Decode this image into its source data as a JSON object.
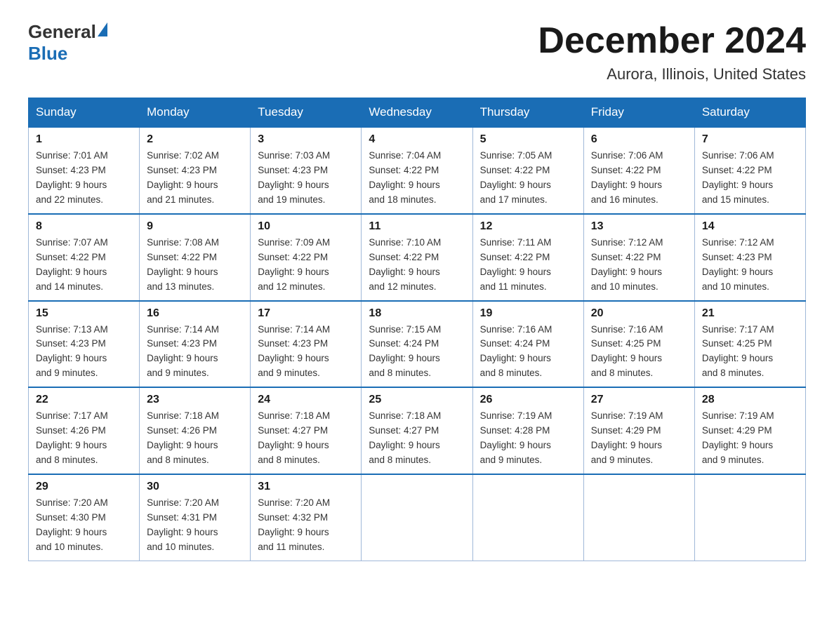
{
  "header": {
    "logo_general": "General",
    "logo_blue": "Blue",
    "month_year": "December 2024",
    "location": "Aurora, Illinois, United States"
  },
  "weekdays": [
    "Sunday",
    "Monday",
    "Tuesday",
    "Wednesday",
    "Thursday",
    "Friday",
    "Saturday"
  ],
  "weeks": [
    [
      {
        "day": "1",
        "sunrise": "7:01 AM",
        "sunset": "4:23 PM",
        "daylight": "9 hours and 22 minutes."
      },
      {
        "day": "2",
        "sunrise": "7:02 AM",
        "sunset": "4:23 PM",
        "daylight": "9 hours and 21 minutes."
      },
      {
        "day": "3",
        "sunrise": "7:03 AM",
        "sunset": "4:23 PM",
        "daylight": "9 hours and 19 minutes."
      },
      {
        "day": "4",
        "sunrise": "7:04 AM",
        "sunset": "4:22 PM",
        "daylight": "9 hours and 18 minutes."
      },
      {
        "day": "5",
        "sunrise": "7:05 AM",
        "sunset": "4:22 PM",
        "daylight": "9 hours and 17 minutes."
      },
      {
        "day": "6",
        "sunrise": "7:06 AM",
        "sunset": "4:22 PM",
        "daylight": "9 hours and 16 minutes."
      },
      {
        "day": "7",
        "sunrise": "7:06 AM",
        "sunset": "4:22 PM",
        "daylight": "9 hours and 15 minutes."
      }
    ],
    [
      {
        "day": "8",
        "sunrise": "7:07 AM",
        "sunset": "4:22 PM",
        "daylight": "9 hours and 14 minutes."
      },
      {
        "day": "9",
        "sunrise": "7:08 AM",
        "sunset": "4:22 PM",
        "daylight": "9 hours and 13 minutes."
      },
      {
        "day": "10",
        "sunrise": "7:09 AM",
        "sunset": "4:22 PM",
        "daylight": "9 hours and 12 minutes."
      },
      {
        "day": "11",
        "sunrise": "7:10 AM",
        "sunset": "4:22 PM",
        "daylight": "9 hours and 12 minutes."
      },
      {
        "day": "12",
        "sunrise": "7:11 AM",
        "sunset": "4:22 PM",
        "daylight": "9 hours and 11 minutes."
      },
      {
        "day": "13",
        "sunrise": "7:12 AM",
        "sunset": "4:22 PM",
        "daylight": "9 hours and 10 minutes."
      },
      {
        "day": "14",
        "sunrise": "7:12 AM",
        "sunset": "4:23 PM",
        "daylight": "9 hours and 10 minutes."
      }
    ],
    [
      {
        "day": "15",
        "sunrise": "7:13 AM",
        "sunset": "4:23 PM",
        "daylight": "9 hours and 9 minutes."
      },
      {
        "day": "16",
        "sunrise": "7:14 AM",
        "sunset": "4:23 PM",
        "daylight": "9 hours and 9 minutes."
      },
      {
        "day": "17",
        "sunrise": "7:14 AM",
        "sunset": "4:23 PM",
        "daylight": "9 hours and 9 minutes."
      },
      {
        "day": "18",
        "sunrise": "7:15 AM",
        "sunset": "4:24 PM",
        "daylight": "9 hours and 8 minutes."
      },
      {
        "day": "19",
        "sunrise": "7:16 AM",
        "sunset": "4:24 PM",
        "daylight": "9 hours and 8 minutes."
      },
      {
        "day": "20",
        "sunrise": "7:16 AM",
        "sunset": "4:25 PM",
        "daylight": "9 hours and 8 minutes."
      },
      {
        "day": "21",
        "sunrise": "7:17 AM",
        "sunset": "4:25 PM",
        "daylight": "9 hours and 8 minutes."
      }
    ],
    [
      {
        "day": "22",
        "sunrise": "7:17 AM",
        "sunset": "4:26 PM",
        "daylight": "9 hours and 8 minutes."
      },
      {
        "day": "23",
        "sunrise": "7:18 AM",
        "sunset": "4:26 PM",
        "daylight": "9 hours and 8 minutes."
      },
      {
        "day": "24",
        "sunrise": "7:18 AM",
        "sunset": "4:27 PM",
        "daylight": "9 hours and 8 minutes."
      },
      {
        "day": "25",
        "sunrise": "7:18 AM",
        "sunset": "4:27 PM",
        "daylight": "9 hours and 8 minutes."
      },
      {
        "day": "26",
        "sunrise": "7:19 AM",
        "sunset": "4:28 PM",
        "daylight": "9 hours and 9 minutes."
      },
      {
        "day": "27",
        "sunrise": "7:19 AM",
        "sunset": "4:29 PM",
        "daylight": "9 hours and 9 minutes."
      },
      {
        "day": "28",
        "sunrise": "7:19 AM",
        "sunset": "4:29 PM",
        "daylight": "9 hours and 9 minutes."
      }
    ],
    [
      {
        "day": "29",
        "sunrise": "7:20 AM",
        "sunset": "4:30 PM",
        "daylight": "9 hours and 10 minutes."
      },
      {
        "day": "30",
        "sunrise": "7:20 AM",
        "sunset": "4:31 PM",
        "daylight": "9 hours and 10 minutes."
      },
      {
        "day": "31",
        "sunrise": "7:20 AM",
        "sunset": "4:32 PM",
        "daylight": "9 hours and 11 minutes."
      },
      null,
      null,
      null,
      null
    ]
  ],
  "labels": {
    "sunrise": "Sunrise:",
    "sunset": "Sunset:",
    "daylight": "Daylight:"
  }
}
